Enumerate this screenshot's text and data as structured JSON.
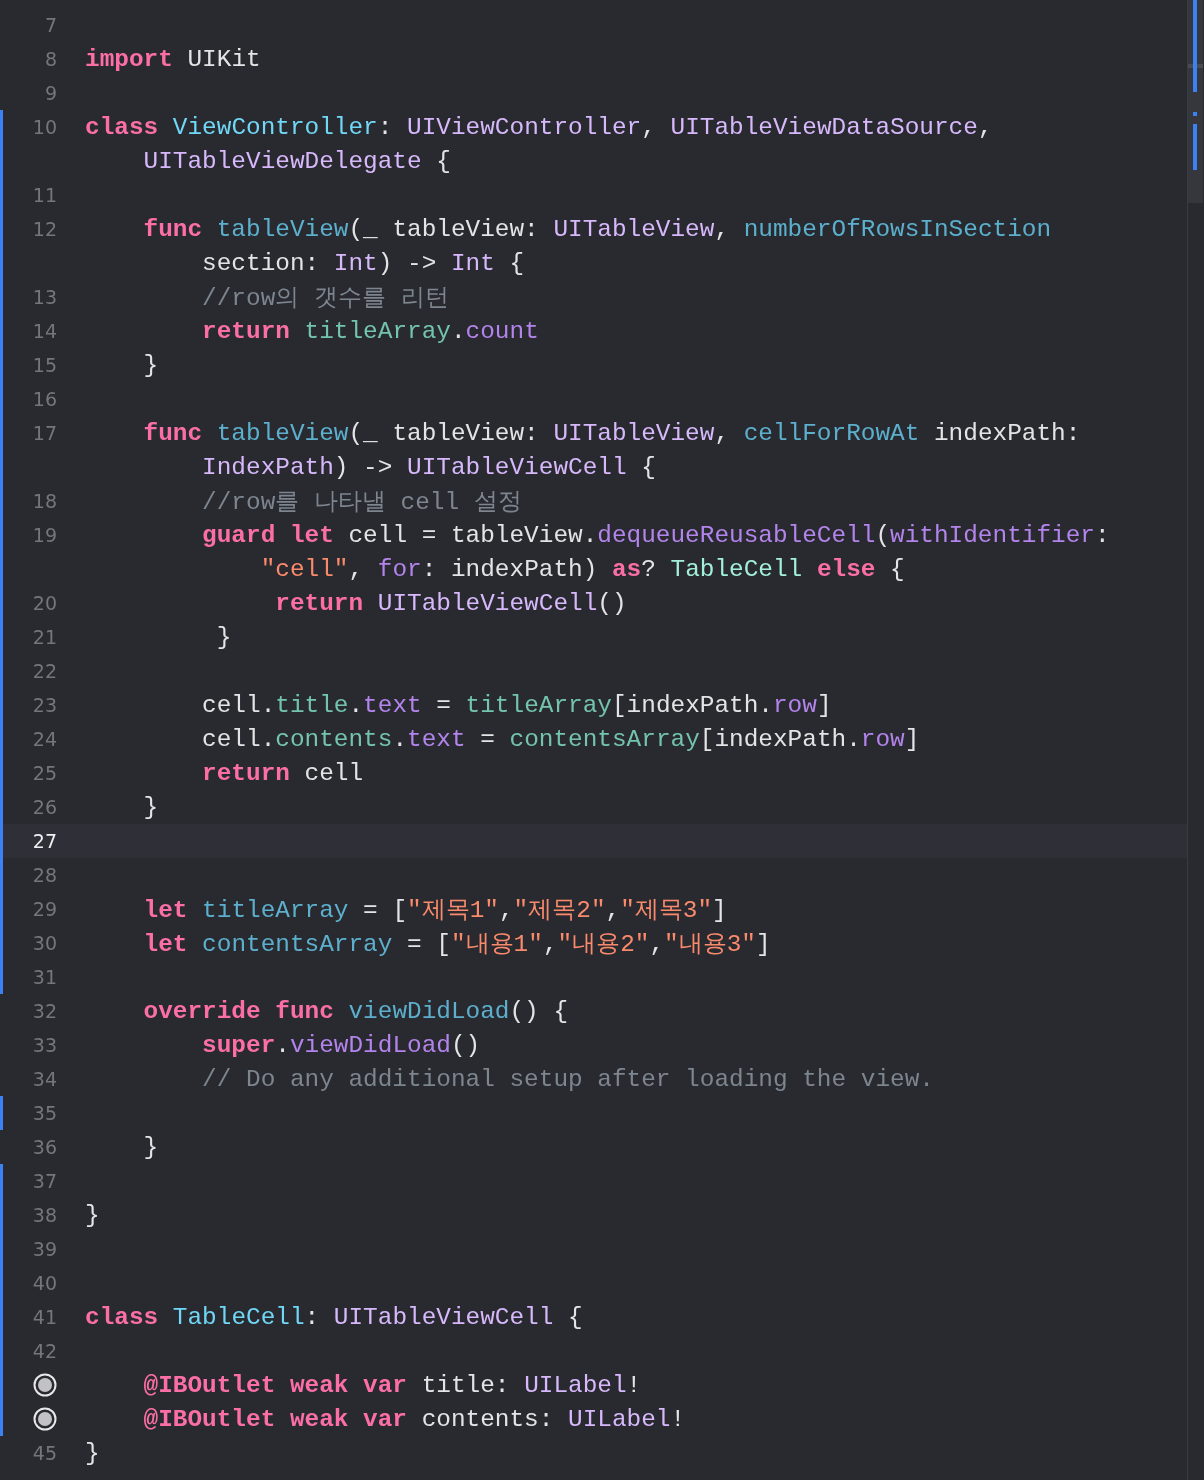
{
  "editor": {
    "lines": [
      {
        "kind": "number",
        "number": "7",
        "changed": false,
        "current": false
      },
      {
        "kind": "number",
        "number": "8",
        "changed": false,
        "current": false,
        "rows": [
          {
            "tokens": [
              {
                "kind": "keyword",
                "text": "import"
              },
              {
                "kind": "plain",
                "text": " UIKit"
              }
            ]
          }
        ]
      },
      {
        "kind": "number",
        "number": "9",
        "changed": false,
        "current": false
      },
      {
        "kind": "number",
        "number": "10",
        "changed": true,
        "current": false,
        "rows": [
          {
            "tokens": [
              {
                "kind": "keyword",
                "text": "class "
              },
              {
                "kind": "declaration",
                "text": "ViewController"
              },
              {
                "kind": "plain",
                "text": ": "
              },
              {
                "kind": "type",
                "text": "UIViewController"
              },
              {
                "kind": "plain",
                "text": ", "
              },
              {
                "kind": "type",
                "text": "UITableViewDataSource"
              },
              {
                "kind": "plain",
                "text": ","
              }
            ]
          },
          {
            "tokens": [
              {
                "kind": "type",
                "text": "    UITableViewDelegate"
              },
              {
                "kind": "plain",
                "text": " {"
              }
            ]
          }
        ]
      },
      {
        "kind": "number",
        "number": "11",
        "changed": true,
        "current": false
      },
      {
        "kind": "number",
        "number": "12",
        "changed": true,
        "current": false,
        "rows": [
          {
            "tokens": [
              {
                "kind": "keyword",
                "text": "    func "
              },
              {
                "kind": "member",
                "text": "tableView"
              },
              {
                "kind": "plain",
                "text": "(_ tableView: "
              },
              {
                "kind": "type",
                "text": "UITableView"
              },
              {
                "kind": "plain",
                "text": ", "
              },
              {
                "kind": "member",
                "text": "numberOfRowsInSection"
              }
            ]
          },
          {
            "tokens": [
              {
                "kind": "plain",
                "text": "        section: "
              },
              {
                "kind": "type",
                "text": "Int"
              },
              {
                "kind": "plain",
                "text": ") -> "
              },
              {
                "kind": "type",
                "text": "Int"
              },
              {
                "kind": "plain",
                "text": " {"
              }
            ]
          }
        ]
      },
      {
        "kind": "number",
        "number": "13",
        "changed": true,
        "current": false,
        "rows": [
          {
            "tokens": [
              {
                "kind": "comment",
                "text": "        //row의 갯수를 리턴"
              }
            ]
          }
        ]
      },
      {
        "kind": "number",
        "number": "14",
        "changed": true,
        "current": false,
        "rows": [
          {
            "tokens": [
              {
                "kind": "keyword",
                "text": "        return "
              },
              {
                "kind": "project",
                "text": "titleArray"
              },
              {
                "kind": "plain",
                "text": "."
              },
              {
                "kind": "system",
                "text": "count"
              }
            ]
          }
        ]
      },
      {
        "kind": "number",
        "number": "15",
        "changed": true,
        "current": false,
        "rows": [
          {
            "tokens": [
              {
                "kind": "plain",
                "text": "    }"
              }
            ]
          }
        ]
      },
      {
        "kind": "number",
        "number": "16",
        "changed": true,
        "current": false
      },
      {
        "kind": "number",
        "number": "17",
        "changed": true,
        "current": false,
        "rows": [
          {
            "tokens": [
              {
                "kind": "keyword",
                "text": "    func "
              },
              {
                "kind": "member",
                "text": "tableView"
              },
              {
                "kind": "plain",
                "text": "(_ tableView: "
              },
              {
                "kind": "type",
                "text": "UITableView"
              },
              {
                "kind": "plain",
                "text": ", "
              },
              {
                "kind": "member",
                "text": "cellForRowAt"
              },
              {
                "kind": "plain",
                "text": " indexPath:"
              }
            ]
          },
          {
            "tokens": [
              {
                "kind": "type",
                "text": "        IndexPath"
              },
              {
                "kind": "plain",
                "text": ") -> "
              },
              {
                "kind": "type",
                "text": "UITableViewCell"
              },
              {
                "kind": "plain",
                "text": " {"
              }
            ]
          }
        ]
      },
      {
        "kind": "number",
        "number": "18",
        "changed": true,
        "current": false,
        "rows": [
          {
            "tokens": [
              {
                "kind": "comment",
                "text": "        //row를 나타낼 cell 설정"
              }
            ]
          }
        ]
      },
      {
        "kind": "number",
        "number": "19",
        "changed": true,
        "current": false,
        "rows": [
          {
            "tokens": [
              {
                "kind": "keyword",
                "text": "        guard let"
              },
              {
                "kind": "plain",
                "text": " cell = tableView."
              },
              {
                "kind": "system",
                "text": "dequeueReusableCell"
              },
              {
                "kind": "plain",
                "text": "("
              },
              {
                "kind": "system",
                "text": "withIdentifier"
              },
              {
                "kind": "plain",
                "text": ":"
              }
            ]
          },
          {
            "tokens": [
              {
                "kind": "string",
                "text": "            \"cell\""
              },
              {
                "kind": "plain",
                "text": ", "
              },
              {
                "kind": "system",
                "text": "for"
              },
              {
                "kind": "plain",
                "text": ": indexPath) "
              },
              {
                "kind": "keyword",
                "text": "as"
              },
              {
                "kind": "plain",
                "text": "? "
              },
              {
                "kind": "projecttype",
                "text": "TableCell"
              },
              {
                "kind": "keyword",
                "text": " else"
              },
              {
                "kind": "plain",
                "text": " {"
              }
            ]
          }
        ]
      },
      {
        "kind": "number",
        "number": "20",
        "changed": true,
        "current": false,
        "rows": [
          {
            "tokens": [
              {
                "kind": "keyword",
                "text": "             return "
              },
              {
                "kind": "type",
                "text": "UITableViewCell"
              },
              {
                "kind": "plain",
                "text": "()"
              }
            ]
          }
        ]
      },
      {
        "kind": "number",
        "number": "21",
        "changed": true,
        "current": false,
        "rows": [
          {
            "tokens": [
              {
                "kind": "plain",
                "text": "         }"
              }
            ]
          }
        ]
      },
      {
        "kind": "number",
        "number": "22",
        "changed": true,
        "current": false
      },
      {
        "kind": "number",
        "number": "23",
        "changed": true,
        "current": false,
        "rows": [
          {
            "tokens": [
              {
                "kind": "plain",
                "text": "        cell."
              },
              {
                "kind": "project",
                "text": "title"
              },
              {
                "kind": "plain",
                "text": "."
              },
              {
                "kind": "system",
                "text": "text"
              },
              {
                "kind": "plain",
                "text": " = "
              },
              {
                "kind": "project",
                "text": "titleArray"
              },
              {
                "kind": "plain",
                "text": "[indexPath."
              },
              {
                "kind": "system",
                "text": "row"
              },
              {
                "kind": "plain",
                "text": "]"
              }
            ]
          }
        ]
      },
      {
        "kind": "number",
        "number": "24",
        "changed": true,
        "current": false,
        "rows": [
          {
            "tokens": [
              {
                "kind": "plain",
                "text": "        cell."
              },
              {
                "kind": "project",
                "text": "contents"
              },
              {
                "kind": "plain",
                "text": "."
              },
              {
                "kind": "system",
                "text": "text"
              },
              {
                "kind": "plain",
                "text": " = "
              },
              {
                "kind": "project",
                "text": "contentsArray"
              },
              {
                "kind": "plain",
                "text": "[indexPath."
              },
              {
                "kind": "system",
                "text": "row"
              },
              {
                "kind": "plain",
                "text": "]"
              }
            ]
          }
        ]
      },
      {
        "kind": "number",
        "number": "25",
        "changed": true,
        "current": false,
        "rows": [
          {
            "tokens": [
              {
                "kind": "keyword",
                "text": "        return"
              },
              {
                "kind": "plain",
                "text": " cell"
              }
            ]
          }
        ]
      },
      {
        "kind": "number",
        "number": "26",
        "changed": true,
        "current": false,
        "rows": [
          {
            "tokens": [
              {
                "kind": "plain",
                "text": "    }"
              }
            ]
          }
        ]
      },
      {
        "kind": "number",
        "number": "27",
        "changed": true,
        "current": true
      },
      {
        "kind": "number",
        "number": "28",
        "changed": true,
        "current": false
      },
      {
        "kind": "number",
        "number": "29",
        "changed": true,
        "current": false,
        "rows": [
          {
            "tokens": [
              {
                "kind": "keyword",
                "text": "    let "
              },
              {
                "kind": "member",
                "text": "titleArray"
              },
              {
                "kind": "plain",
                "text": " = ["
              },
              {
                "kind": "string",
                "text": "\"제목1\""
              },
              {
                "kind": "plain",
                "text": ","
              },
              {
                "kind": "string",
                "text": "\"제목2\""
              },
              {
                "kind": "plain",
                "text": ","
              },
              {
                "kind": "string",
                "text": "\"제목3\""
              },
              {
                "kind": "plain",
                "text": "]"
              }
            ]
          }
        ]
      },
      {
        "kind": "number",
        "number": "30",
        "changed": true,
        "current": false,
        "rows": [
          {
            "tokens": [
              {
                "kind": "keyword",
                "text": "    let "
              },
              {
                "kind": "member",
                "text": "contentsArray"
              },
              {
                "kind": "plain",
                "text": " = ["
              },
              {
                "kind": "string",
                "text": "\"내용1\""
              },
              {
                "kind": "plain",
                "text": ","
              },
              {
                "kind": "string",
                "text": "\"내용2\""
              },
              {
                "kind": "plain",
                "text": ","
              },
              {
                "kind": "string",
                "text": "\"내용3\""
              },
              {
                "kind": "plain",
                "text": "]"
              }
            ]
          }
        ]
      },
      {
        "kind": "number",
        "number": "31",
        "changed": true,
        "current": false
      },
      {
        "kind": "number",
        "number": "32",
        "changed": false,
        "current": false,
        "rows": [
          {
            "tokens": [
              {
                "kind": "keyword",
                "text": "    override func "
              },
              {
                "kind": "member",
                "text": "viewDidLoad"
              },
              {
                "kind": "plain",
                "text": "() {"
              }
            ]
          }
        ]
      },
      {
        "kind": "number",
        "number": "33",
        "changed": false,
        "current": false,
        "rows": [
          {
            "tokens": [
              {
                "kind": "keyword",
                "text": "        super"
              },
              {
                "kind": "plain",
                "text": "."
              },
              {
                "kind": "system",
                "text": "viewDidLoad"
              },
              {
                "kind": "plain",
                "text": "()"
              }
            ]
          }
        ]
      },
      {
        "kind": "number",
        "number": "34",
        "changed": false,
        "current": false,
        "rows": [
          {
            "tokens": [
              {
                "kind": "comment",
                "text": "        // Do any additional setup after loading the view."
              }
            ]
          }
        ]
      },
      {
        "kind": "number",
        "number": "35",
        "changed": true,
        "current": false
      },
      {
        "kind": "number",
        "number": "36",
        "changed": false,
        "current": false,
        "rows": [
          {
            "tokens": [
              {
                "kind": "plain",
                "text": "    }"
              }
            ]
          }
        ]
      },
      {
        "kind": "number",
        "number": "37",
        "changed": true,
        "current": false
      },
      {
        "kind": "number",
        "number": "38",
        "changed": true,
        "current": false,
        "rows": [
          {
            "tokens": [
              {
                "kind": "plain",
                "text": "}"
              }
            ]
          }
        ]
      },
      {
        "kind": "number",
        "number": "39",
        "changed": true,
        "current": false
      },
      {
        "kind": "number",
        "number": "40",
        "changed": true,
        "current": false
      },
      {
        "kind": "number",
        "number": "41",
        "changed": true,
        "current": false,
        "rows": [
          {
            "tokens": [
              {
                "kind": "keyword",
                "text": "class "
              },
              {
                "kind": "declaration",
                "text": "TableCell"
              },
              {
                "kind": "plain",
                "text": ": "
              },
              {
                "kind": "type",
                "text": "UITableViewCell"
              },
              {
                "kind": "plain",
                "text": " {"
              }
            ]
          }
        ]
      },
      {
        "kind": "number",
        "number": "42",
        "changed": true,
        "current": false
      },
      {
        "kind": "outlet",
        "changed": true,
        "current": false,
        "rows": [
          {
            "tokens": [
              {
                "kind": "keyword",
                "text": "    @IBOutlet weak var"
              },
              {
                "kind": "plain",
                "text": " title: "
              },
              {
                "kind": "type",
                "text": "UILabel"
              },
              {
                "kind": "plain",
                "text": "!"
              }
            ]
          }
        ]
      },
      {
        "kind": "outlet",
        "changed": true,
        "current": false,
        "rows": [
          {
            "tokens": [
              {
                "kind": "keyword",
                "text": "    @IBOutlet weak var"
              },
              {
                "kind": "plain",
                "text": " contents: "
              },
              {
                "kind": "type",
                "text": "UILabel"
              },
              {
                "kind": "plain",
                "text": "!"
              }
            ]
          }
        ]
      },
      {
        "kind": "number",
        "number": "45",
        "changed": false,
        "current": false,
        "rows": [
          {
            "tokens": [
              {
                "kind": "plain",
                "text": "}"
              }
            ]
          }
        ]
      }
    ]
  }
}
